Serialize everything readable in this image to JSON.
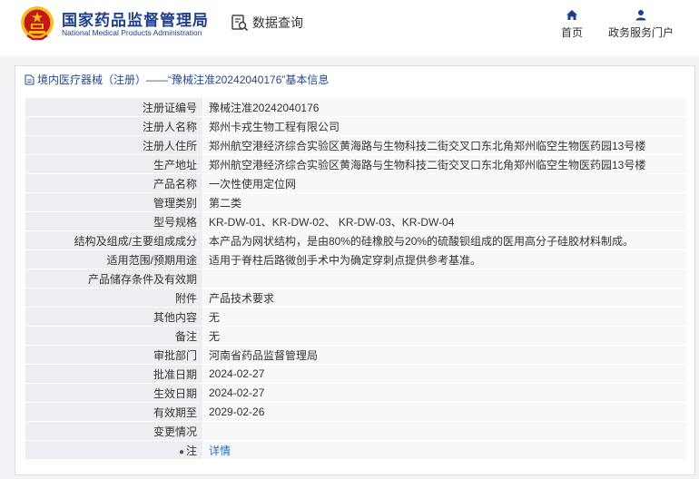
{
  "header": {
    "org_cn": "国家药品监督管理局",
    "org_en": "National Medical Products Administration",
    "query_label": "数据查询",
    "nav": [
      {
        "label": "首页",
        "icon": "home-icon"
      },
      {
        "label": "政务服务门户",
        "icon": "user-icon"
      }
    ]
  },
  "panel": {
    "title": "境内医疗器械（注册）——“豫械注准20242040176”基本信息",
    "rows": [
      {
        "label": "注册证编号",
        "value": "豫械注准20242040176"
      },
      {
        "label": "注册人名称",
        "value": "郑州卡戎生物工程有限公司"
      },
      {
        "label": "注册人住所",
        "value": "郑州航空港经济综合实验区黄海路与生物科技二街交叉口东北角郑州临空生物医药园13号楼"
      },
      {
        "label": "生产地址",
        "value": "郑州航空港经济综合实验区黄海路与生物科技二街交叉口东北角郑州临空生物医药园13号楼"
      },
      {
        "label": "产品名称",
        "value": "一次性使用定位网"
      },
      {
        "label": "管理类别",
        "value": "第二类"
      },
      {
        "label": "型号规格",
        "value": "KR-DW-01、KR-DW-02、 KR-DW-03、KR-DW-04"
      },
      {
        "label": "结构及组成/主要组成成分",
        "value": "本产品为网状结构，是由80%的硅橡胶与20%的硫酸钡组成的医用高分子硅胶材料制成。"
      },
      {
        "label": "适用范围/预期用途",
        "value": "适用于脊柱后路微创手术中为确定穿刺点提供参考基准。"
      },
      {
        "label": "产品储存条件及有效期",
        "value": ""
      },
      {
        "label": "附件",
        "value": "产品技术要求"
      },
      {
        "label": "其他内容",
        "value": "无"
      },
      {
        "label": "备注",
        "value": "无"
      },
      {
        "label": "审批部门",
        "value": "河南省药品监督管理局"
      },
      {
        "label": "批准日期",
        "value": "2024-02-27"
      },
      {
        "label": "生效日期",
        "value": "2024-02-27"
      },
      {
        "label": "有效期至",
        "value": "2029-02-26"
      },
      {
        "label": "变更情况",
        "value": ""
      },
      {
        "label": "注",
        "value": "详情"
      }
    ]
  },
  "colors": {
    "brand_blue": "#1f3f8c",
    "link_blue": "#2b6cc4",
    "emblem_red": "#c8161d",
    "emblem_gold": "#f2c21a"
  }
}
